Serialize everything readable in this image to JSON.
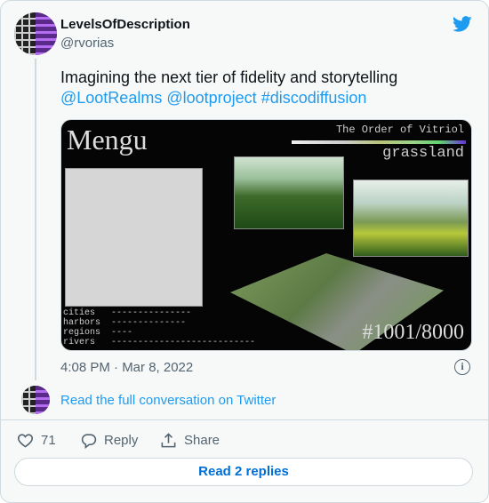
{
  "author": {
    "name": "LevelsOfDescription",
    "handle": "@rvorias"
  },
  "tweet": {
    "text": "Imagining the next tier of fidelity and storytelling",
    "mentions": [
      "@LootRealms",
      "@lootproject",
      "#discodiffusion"
    ],
    "timestamp": "4:08 PM · Mar 8, 2022"
  },
  "media": {
    "title": "Mengu",
    "order": "The Order of Vitriol",
    "biome": "grassland",
    "legend": "cities   ---------------\nharbors  --------------\nregions  ----\nrivers   ---------------------------",
    "number": "#1001/8000"
  },
  "conversation_link": "Read the full conversation on Twitter",
  "actions": {
    "likes": "71",
    "reply": "Reply",
    "share": "Share"
  },
  "replies_button": "Read 2 replies",
  "colors": {
    "accent": "#1d9bf0",
    "text": "#0f1419",
    "muted": "#536471"
  }
}
